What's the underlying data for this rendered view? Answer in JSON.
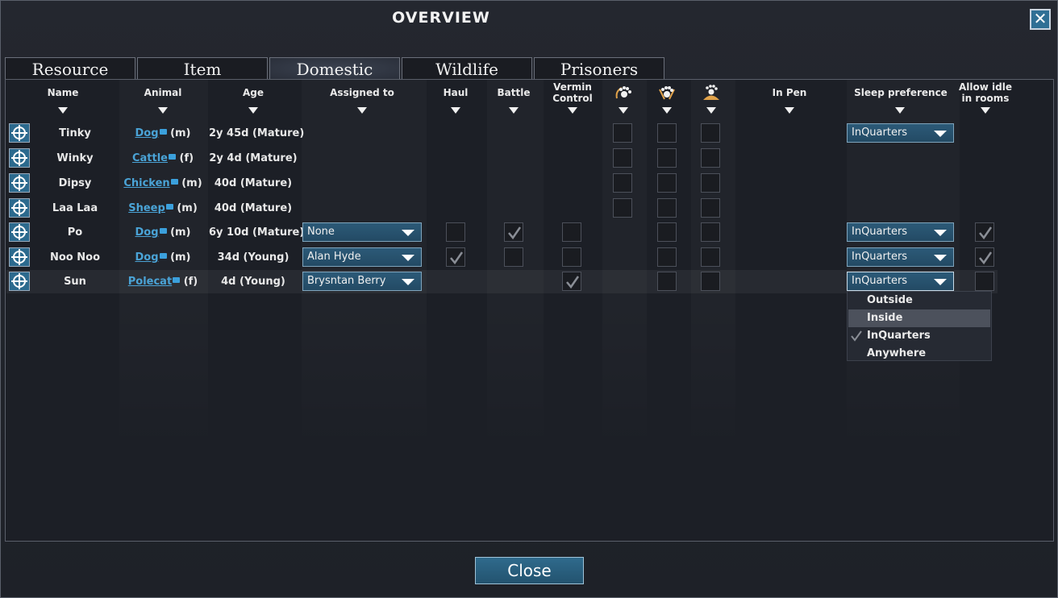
{
  "window": {
    "title": "OVERVIEW",
    "close_glyph": "✕"
  },
  "tabs": [
    {
      "label": "Resource"
    },
    {
      "label": "Item"
    },
    {
      "label": "Domestic"
    },
    {
      "label": "Wildlife"
    },
    {
      "label": "Prisoners"
    }
  ],
  "active_tab": "Domestic",
  "columns": {
    "name": "Name",
    "animal": "Animal",
    "age": "Age",
    "assigned_to": "Assigned to",
    "haul": "Haul",
    "battle": "Battle",
    "vermin_1": "Vermin",
    "vermin_2": "Control",
    "in_pen": "In Pen",
    "sleep_preference": "Sleep preference",
    "allow_idle_1": "Allow idle",
    "allow_idle_2": "in rooms"
  },
  "column_icons": [
    "paw-claw-icon",
    "paw-bowl-icon",
    "paw-hill-icon"
  ],
  "rows": [
    {
      "name": "Tinky",
      "animal": "Dog",
      "sex": "(m)",
      "age": "2y 45d (Mature)",
      "sleep": "InQuarters"
    },
    {
      "name": "Winky",
      "animal": "Cattle",
      "sex": "(f)",
      "age": "2y 4d (Mature)"
    },
    {
      "name": "Dipsy",
      "animal": "Chicken",
      "sex": "(m)",
      "age": "40d (Mature)"
    },
    {
      "name": "Laa Laa",
      "animal": "Sheep",
      "sex": "(m)",
      "age": "40d (Mature)"
    },
    {
      "name": "Po",
      "animal": "Dog",
      "sex": "(m)",
      "age": "6y 10d (Mature)",
      "assigned": "None",
      "sleep": "InQuarters"
    },
    {
      "name": "Noo Noo",
      "animal": "Dog",
      "sex": "(m)",
      "age": "34d (Young)",
      "assigned": "Alan Hyde",
      "sleep": "InQuarters"
    },
    {
      "name": "Sun",
      "animal": "Polecat",
      "sex": "(f)",
      "age": "4d (Young)",
      "assigned": "Brysntan Berry",
      "sleep": "InQuarters"
    }
  ],
  "sleep_menu": {
    "options": [
      "Outside",
      "Inside",
      "InQuarters",
      "Anywhere"
    ],
    "highlighted": "Inside",
    "selected": "InQuarters"
  },
  "footer": {
    "close_label": "Close"
  },
  "colors": {
    "accent": "#2f6a8c",
    "link": "#4aa3d6",
    "background": "#1f222a"
  }
}
